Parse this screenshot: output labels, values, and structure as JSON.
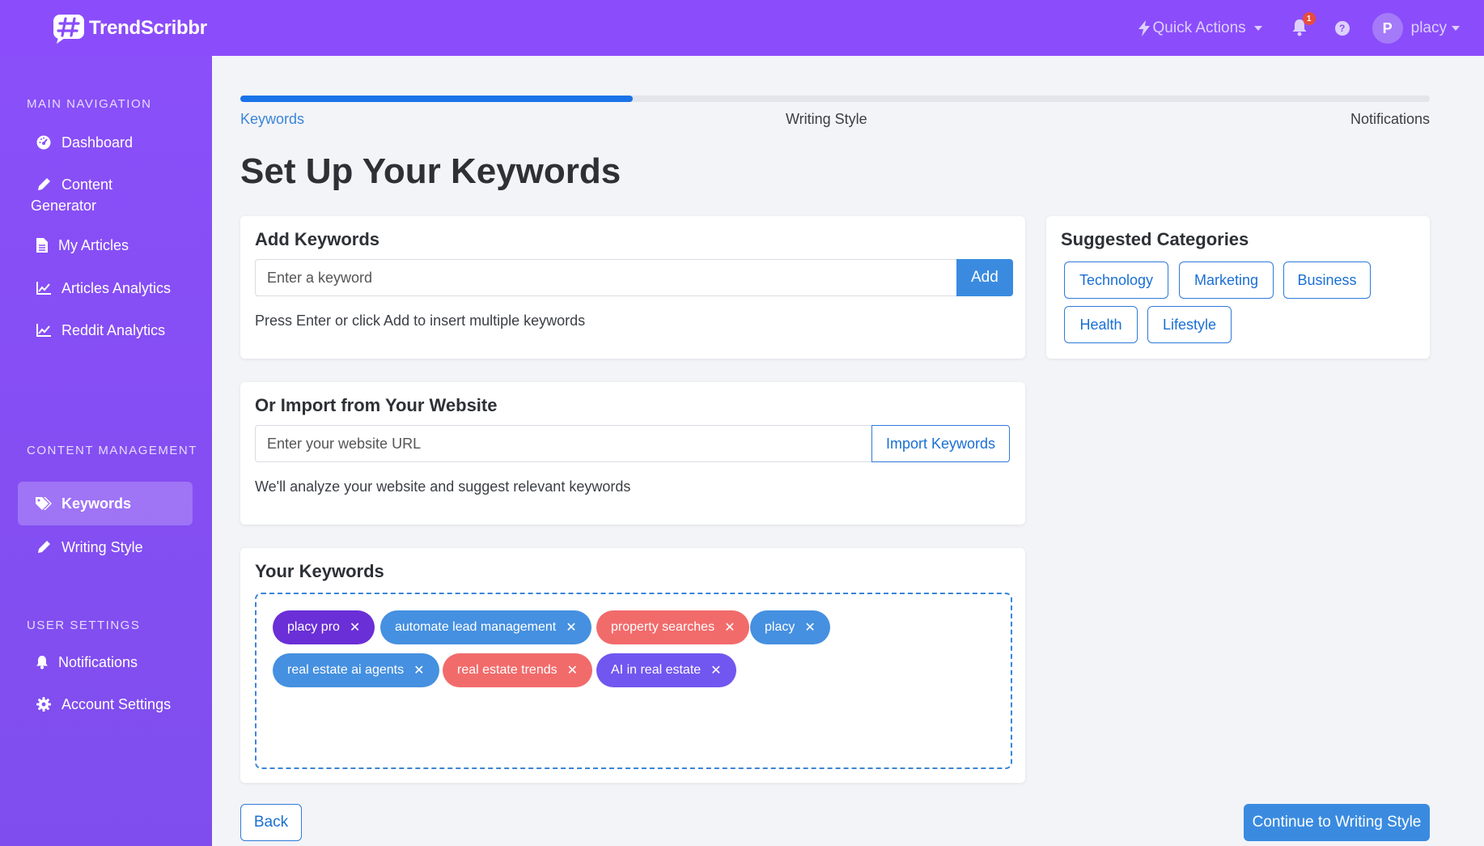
{
  "app": {
    "name": "TrendScribbr"
  },
  "topbar": {
    "quick_actions": "Quick Actions",
    "notification_count": "1",
    "help_glyph": "?",
    "avatar_initial": "P",
    "user_name": "placy"
  },
  "sidebar": {
    "sections": [
      {
        "title": "MAIN NAVIGATION"
      },
      {
        "title": "CONTENT MANAGEMENT"
      },
      {
        "title": "USER SETTINGS"
      }
    ],
    "items": [
      {
        "label": "Dashboard",
        "icon": "dashboard-icon"
      },
      {
        "label": "Content",
        "label2": "Generator",
        "icon": "pencil-icon"
      },
      {
        "label": "My Articles",
        "icon": "file-icon"
      },
      {
        "label": "Articles Analytics",
        "icon": "chart-line-icon"
      },
      {
        "label": "Reddit Analytics",
        "icon": "chart-line-icon"
      },
      {
        "label": "Keywords",
        "icon": "tags-icon",
        "active": true
      },
      {
        "label": "Writing Style",
        "icon": "pencil-icon"
      },
      {
        "label": "Notifications",
        "icon": "bell-icon"
      },
      {
        "label": "Account Settings",
        "icon": "gear-icon"
      }
    ]
  },
  "progress": {
    "value_percent": 33,
    "steps": [
      "Keywords",
      "Writing Style",
      "Notifications"
    ]
  },
  "page": {
    "title": "Set Up Your Keywords"
  },
  "add_keywords": {
    "title": "Add Keywords",
    "placeholder": "Enter a keyword",
    "button": "Add",
    "help": "Press Enter or click Add to insert multiple keywords"
  },
  "import": {
    "title": "Or Import from Your Website",
    "placeholder": "Enter your website URL",
    "button": "Import Keywords",
    "help": "We'll analyze your website and suggest relevant keywords"
  },
  "suggested": {
    "title": "Suggested Categories",
    "categories": [
      "Technology",
      "Marketing",
      "Business",
      "Health",
      "Lifestyle"
    ]
  },
  "your_keywords": {
    "title": "Your Keywords",
    "remove_glyph": "✕",
    "chips": [
      {
        "label": "placy pro",
        "color": "#6a2fd6"
      },
      {
        "label": "automate lead management",
        "color": "#4590e0"
      },
      {
        "label": "property searches",
        "color": "#f26b6b"
      },
      {
        "label": "placy",
        "color": "#4590e0"
      },
      {
        "label": "real estate ai agents",
        "color": "#4590e0"
      },
      {
        "label": "real estate trends",
        "color": "#f26b6b"
      },
      {
        "label": "AI in real estate",
        "color": "#7157f0"
      }
    ]
  },
  "footer": {
    "back": "Back",
    "continue": "Continue to Writing Style"
  },
  "colors": {
    "topbar": "#8b4dfb",
    "primary": "#3a8be0",
    "progress": "#1a73e8"
  }
}
